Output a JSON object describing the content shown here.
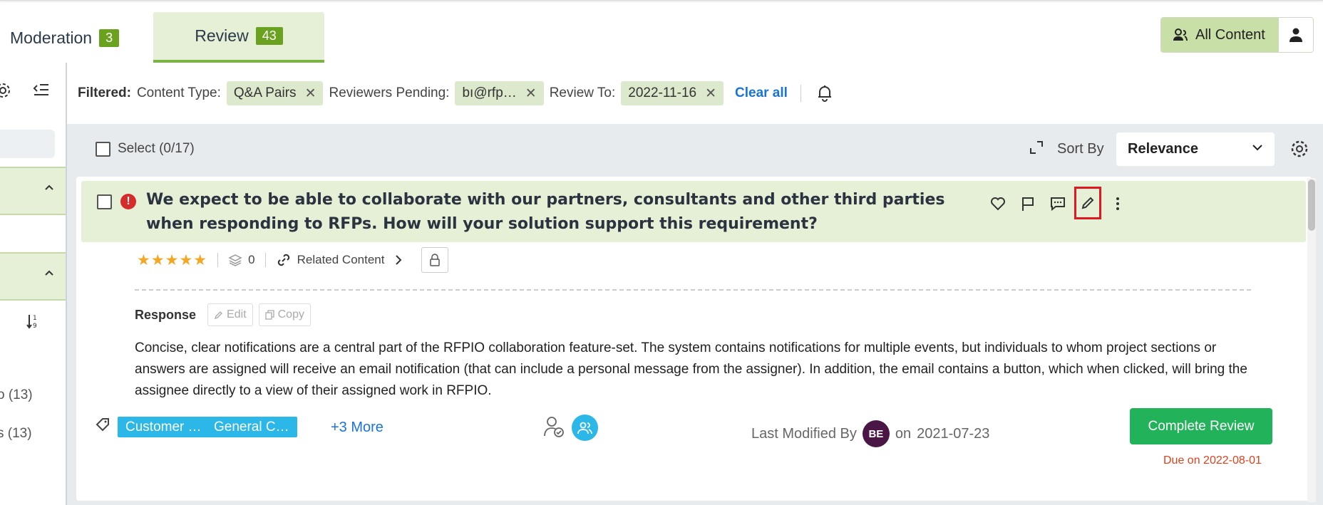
{
  "tabs": [
    {
      "label": "Moderation",
      "count": "3"
    },
    {
      "label": "Review",
      "count": "43"
    }
  ],
  "header": {
    "all_content_label": "All Content"
  },
  "sidebar": {
    "items": [
      {
        "label": "o (13)"
      },
      {
        "label": "s (13)"
      }
    ]
  },
  "filters": {
    "label": "Filtered:",
    "content_type_label": "Content Type:",
    "content_type_value": "Q&A Pairs",
    "reviewers_label": "Reviewers Pending:",
    "reviewers_value": "bı@rfp…",
    "review_to_label": "Review To:",
    "review_to_value": "2022-11-16",
    "remove_glyph": "✕",
    "clear_all": "Clear all"
  },
  "list": {
    "select_label": "Select (0/17)",
    "sort_label": "Sort By",
    "sort_value": "Relevance"
  },
  "card": {
    "question": "We expect to be able to collaborate with our partners, consultants and other third parties when responding to RFPs. How will your solution support this requirement?",
    "rating_stars": "★★★★★",
    "rating": 5,
    "usage_count": "0",
    "related_content": "Related Content",
    "response_label": "Response",
    "edit_label": "Edit",
    "copy_label": "Copy",
    "response_text": "Concise, clear notifications are a central part of the RFPIO collaboration feature-set. The system contains notifications for multiple events, but individuals to whom project sections or answers are assigned will receive an email notification (that can include a personal message from the assigner). In addition, the email contains a button, which when clicked, will bring the assignee directly to a view of their assigned work in RFPIO.",
    "tags": [
      "Customer …",
      "General C…"
    ],
    "more_tags": "+3 More",
    "last_modified_label": "Last Modified By",
    "last_modified_initials": "BE",
    "last_modified_on": "on",
    "last_modified_date": "2021-07-23",
    "complete_button": "Complete Review",
    "due": "Due on 2022-08-01"
  },
  "colors": {
    "accent_green": "#7cb342",
    "tag_blue": "#2bb7e8",
    "complete_green": "#21b25a",
    "due_red": "#e0401b",
    "highlight_red": "#e0181f"
  },
  "icons": [
    "gear-icon",
    "collapse-sidebar-icon",
    "chevron-up-icon",
    "sort-icon",
    "bell-icon",
    "expand-icon",
    "chevron-down-icon",
    "settings-icon",
    "alert-icon",
    "heart-icon",
    "flag-icon",
    "comment-icon",
    "pencil-icon",
    "more-vertical-icon",
    "stack-icon",
    "link-icon",
    "chevron-right-icon",
    "lock-icon",
    "tag-icon",
    "user-check-icon",
    "users-icon",
    "user-icon"
  ]
}
